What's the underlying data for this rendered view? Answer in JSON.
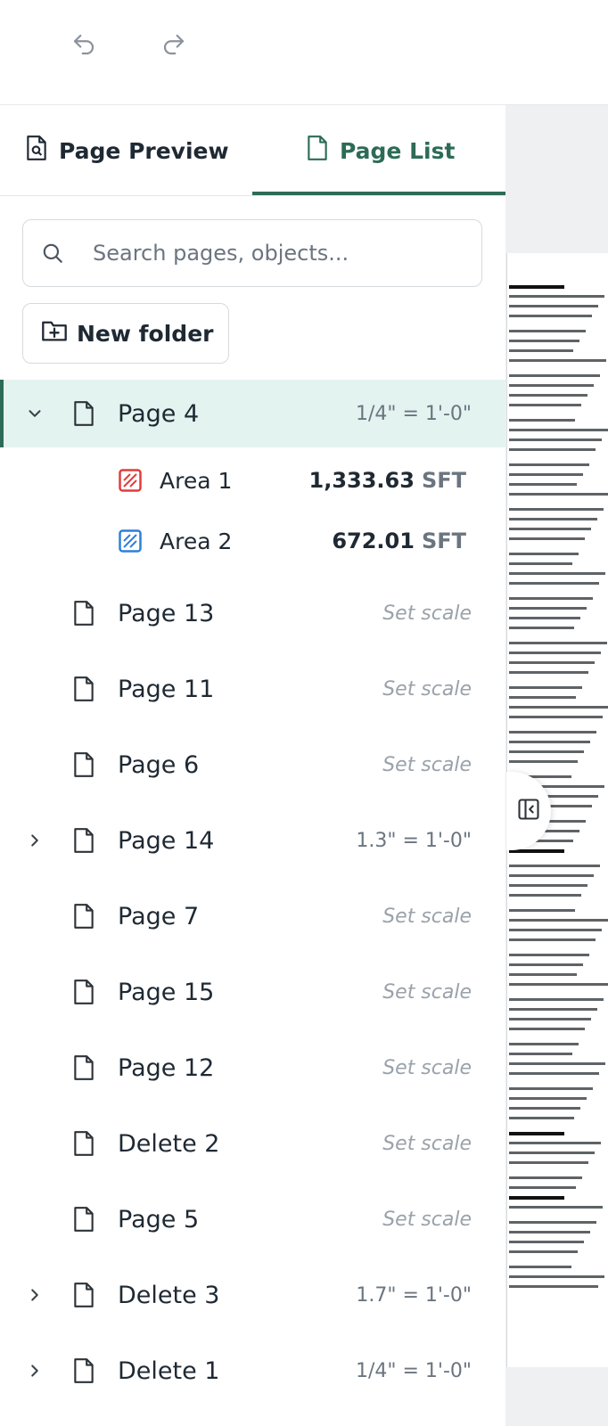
{
  "tabs": {
    "preview": "Page Preview",
    "list": "Page List"
  },
  "search": {
    "placeholder": "Search pages, objects..."
  },
  "new_folder": "New folder",
  "pages": [
    {
      "name": "Page 4",
      "scale": "1/4\" = 1'-0\"",
      "expand": "down",
      "active": true,
      "scale_set": true
    },
    {
      "name": "Page 13",
      "scale": "Set scale",
      "expand": "none",
      "scale_set": false
    },
    {
      "name": "Page 11",
      "scale": "Set scale",
      "expand": "none",
      "scale_set": false
    },
    {
      "name": "Page 6",
      "scale": "Set scale",
      "expand": "none",
      "scale_set": false
    },
    {
      "name": "Page 14",
      "scale": "1.3\" = 1'-0\"",
      "expand": "right",
      "scale_set": true
    },
    {
      "name": "Page 7",
      "scale": "Set scale",
      "expand": "none",
      "scale_set": false
    },
    {
      "name": "Page 15",
      "scale": "Set scale",
      "expand": "none",
      "scale_set": false
    },
    {
      "name": "Page 12",
      "scale": "Set scale",
      "expand": "none",
      "scale_set": false
    },
    {
      "name": "Delete 2",
      "scale": "Set scale",
      "expand": "none",
      "scale_set": false
    },
    {
      "name": "Page 5",
      "scale": "Set scale",
      "expand": "none",
      "scale_set": false
    },
    {
      "name": "Delete 3",
      "scale": "1.7\" = 1'-0\"",
      "expand": "right",
      "scale_set": true
    },
    {
      "name": "Delete 1",
      "scale": "1/4\" = 1'-0\"",
      "expand": "right",
      "scale_set": true
    }
  ],
  "areas": [
    {
      "name": "Area 1",
      "value": "1,333.63",
      "unit": "SFT",
      "color": "#e23b3b"
    },
    {
      "name": "Area 2",
      "value": "672.01",
      "unit": "SFT",
      "color": "#2f7fd8"
    }
  ],
  "colors": {
    "accent": "#2d6b57",
    "active_bg": "#e3f3f0"
  }
}
